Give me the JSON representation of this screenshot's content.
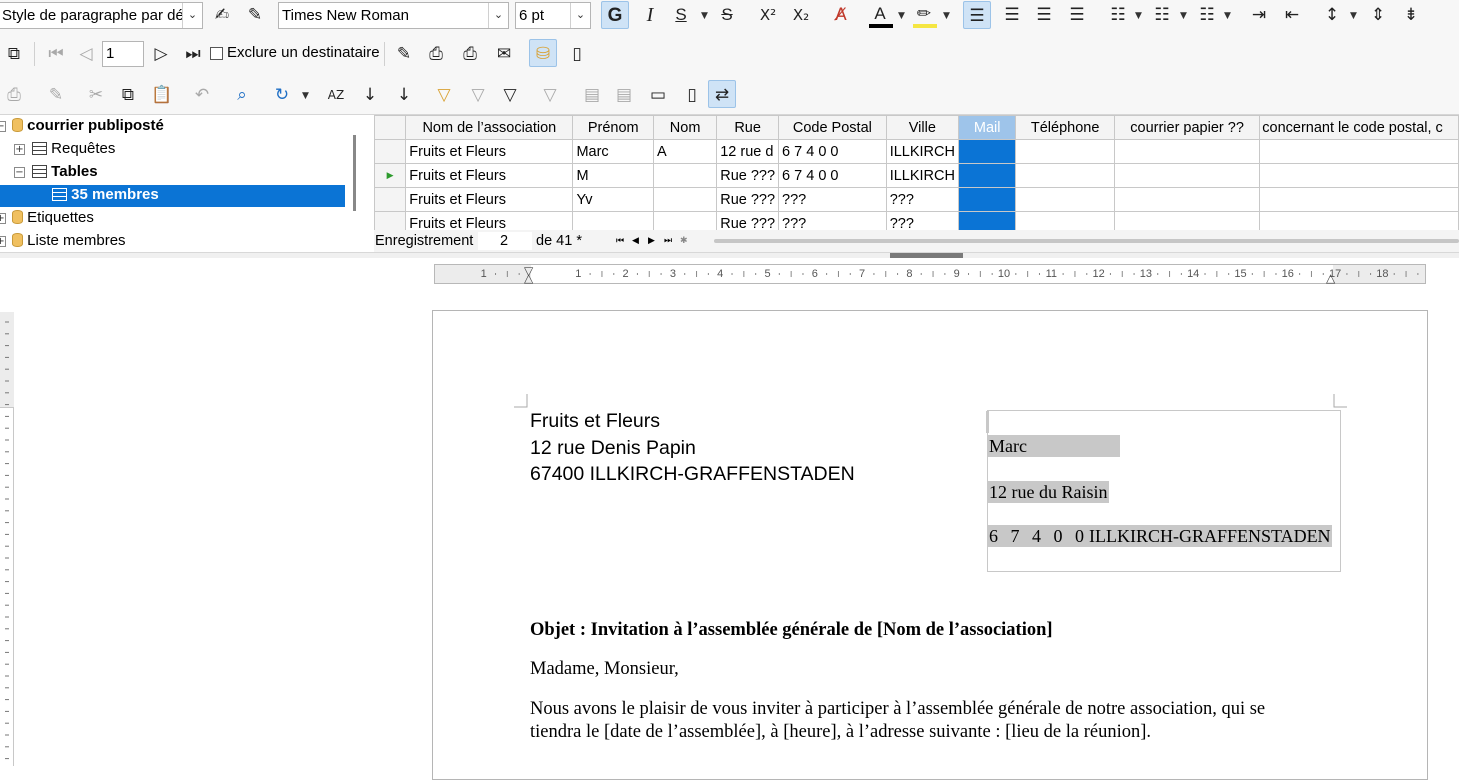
{
  "toolbar_format": {
    "paragraph_style": "Style de paragraphe par déf",
    "font_name": "Times New Roman",
    "font_size": "6 pt"
  },
  "mailmerge_toolbar": {
    "record_number": "1",
    "exclude_label": "Exclure un destinataire"
  },
  "navigator": {
    "items": [
      {
        "label": "courrier publiposté"
      },
      {
        "label": "Requêtes"
      },
      {
        "label": "Tables"
      },
      {
        "label": "35 membres"
      },
      {
        "label": "Etiquettes"
      },
      {
        "label": "Liste membres"
      }
    ]
  },
  "grid": {
    "columns": [
      "Nom de l’association",
      "Prénom",
      "Nom",
      "Rue",
      "Code Postal",
      "Ville",
      "Mail",
      "Téléphone",
      "courrier papier ??",
      "concernant le code postal, c"
    ],
    "rows": [
      [
        "Fruits et Fleurs",
        "Marc",
        "A",
        "12 rue d",
        "6 7 4 0 0",
        "ILLKIRCH",
        "",
        "",
        "",
        ""
      ],
      [
        "Fruits et Fleurs",
        "M",
        "",
        "Rue ???",
        "6 7 4 0 0",
        "ILLKIRCH",
        "",
        "",
        "",
        ""
      ],
      [
        "Fruits et Fleurs",
        "Yv",
        "",
        "Rue ???",
        "???",
        "???",
        "",
        "",
        "",
        ""
      ],
      [
        "Fruits et Fleurs",
        "",
        "",
        "Rue ???",
        "???",
        "???",
        "",
        "",
        "",
        ""
      ]
    ]
  },
  "record_bar": {
    "label": "Enregistrement",
    "current": "2",
    "of_label": "de 41 *"
  },
  "ruler": {
    "ticks": [
      "1",
      "1",
      "2",
      "3",
      "4",
      "5",
      "6",
      "7",
      "8",
      "9",
      "10",
      "11",
      "12",
      "13",
      "14",
      "15",
      "16",
      "17",
      "18"
    ]
  },
  "document": {
    "sender": [
      "Fruits et Fleurs",
      "12 rue Denis Papin",
      "67400 ILLKIRCH-GRAFFENSTADEN"
    ],
    "recipient": {
      "first_name": "Marc",
      "street": "12 rue du Raisin",
      "postal_code": "6 7 4 0 0",
      "city": "ILLKIRCH-GRAFFENSTADEN"
    },
    "subject": "Objet : Invitation à l’assemblée générale de [Nom de l’association]",
    "salutation": "Madame, Monsieur,",
    "paragraph_line1": "Nous avons le plaisir de vous inviter à participer à l’assemblée générale de notre association, qui se",
    "paragraph_line2": "tiendra le [date de l’assemblée], à [heure], à l’adresse suivante : [lieu de la réunion]."
  }
}
